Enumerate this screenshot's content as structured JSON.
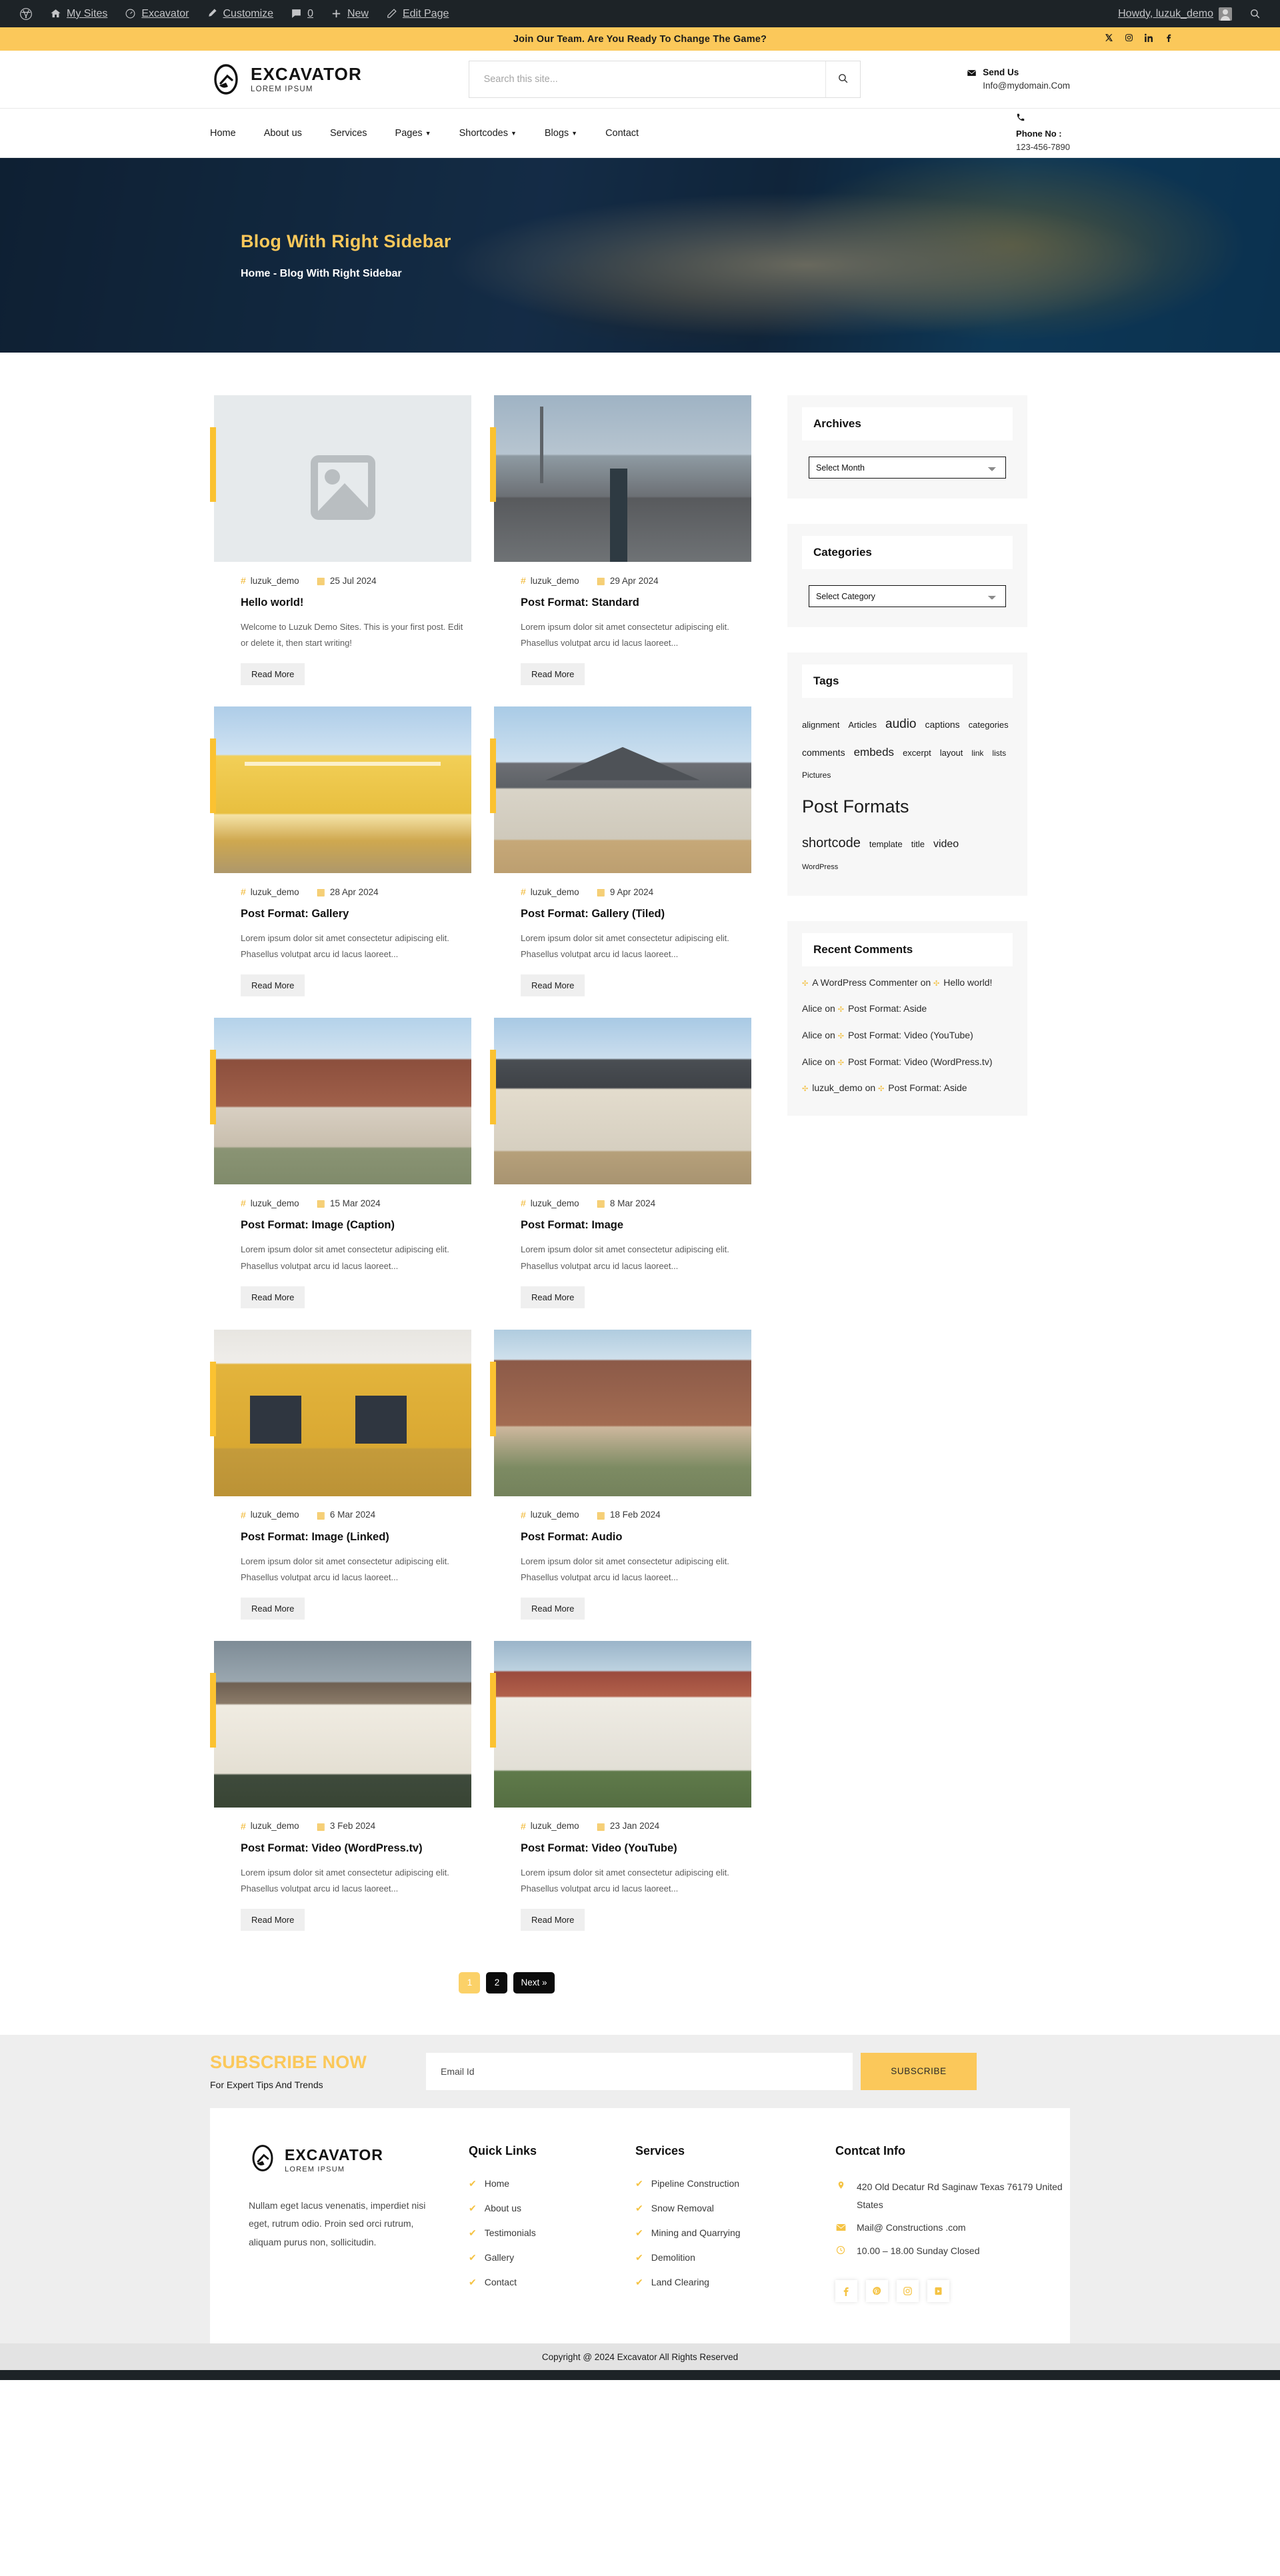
{
  "adminbar": {
    "items": [
      {
        "icon": "wordpress-icon",
        "label": ""
      },
      {
        "icon": "sites-icon",
        "label": "My Sites"
      },
      {
        "icon": "dashboard-icon",
        "label": "Excavator"
      },
      {
        "icon": "brush-icon",
        "label": "Customize"
      },
      {
        "icon": "comment-icon",
        "label": "0"
      },
      {
        "icon": "plus-icon",
        "label": "New"
      },
      {
        "icon": "pencil-icon",
        "label": "Edit Page"
      }
    ],
    "howdy": "Howdy, luzuk_demo",
    "search_icon": "search-icon"
  },
  "topbar": {
    "text": "Join Our Team. Are You Ready To Change The Game?",
    "social": [
      "twitter-x-icon",
      "instagram-icon",
      "linkedin-icon",
      "facebook-icon"
    ]
  },
  "header": {
    "brand_name": "EXCAVATOR",
    "brand_tagline": "LOREM IPSUM",
    "search_placeholder": "Search this site...",
    "search_value": "",
    "contact_label": "Send Us",
    "contact_value": "Info@mydomain.Com"
  },
  "nav": {
    "items": [
      {
        "label": "Home",
        "caret": false
      },
      {
        "label": "About us",
        "caret": false
      },
      {
        "label": "Services",
        "caret": false
      },
      {
        "label": "Pages",
        "caret": true
      },
      {
        "label": "Shortcodes",
        "caret": true
      },
      {
        "label": "Blogs",
        "caret": true
      },
      {
        "label": "Contact",
        "caret": false
      }
    ],
    "phone_label": "Phone No :",
    "phone_value": "123-456-7890"
  },
  "hero": {
    "title": "Blog With Right Sidebar",
    "breadcrumb": "Home - Blog With Right Sidebar"
  },
  "posts": [
    {
      "author": "luzuk_demo",
      "date": "25 Jul 2024",
      "title": "Hello world!",
      "excerpt": "Welcome to Luzuk Demo Sites. This is your first post. Edit or delete it, then start writing!",
      "read_more": "Read More",
      "thumb": "placeholder"
    },
    {
      "author": "luzuk_demo",
      "date": "29 Apr 2024",
      "title": "Post Format: Standard",
      "excerpt": "Lorem ipsum dolor sit amet consectetur adipiscing elit. Phasellus volutpat arcu id lacus laoreet...",
      "read_more": "Read More",
      "thumb": "t-construction"
    },
    {
      "author": "luzuk_demo",
      "date": "28 Apr 2024",
      "title": "Post Format: Gallery",
      "excerpt": "Lorem ipsum dolor sit amet consectetur adipiscing elit. Phasellus volutpat arcu id lacus laoreet...",
      "read_more": "Read More",
      "thumb": "t-yellowbldg"
    },
    {
      "author": "luzuk_demo",
      "date": "9 Apr 2024",
      "title": "Post Format: Gallery (Tiled)",
      "excerpt": "Lorem ipsum dolor sit amet consectetur adipiscing elit. Phasellus volutpat arcu id lacus laoreet...",
      "read_more": "Read More",
      "thumb": "t-house1"
    },
    {
      "author": "luzuk_demo",
      "date": "15 Mar 2024",
      "title": "Post Format: Image (Caption)",
      "excerpt": "Lorem ipsum dolor sit amet consectetur adipiscing elit. Phasellus volutpat arcu id lacus laoreet...",
      "read_more": "Read More",
      "thumb": "t-houses"
    },
    {
      "author": "luzuk_demo",
      "date": "8 Mar 2024",
      "title": "Post Format: Image",
      "excerpt": "Lorem ipsum dolor sit amet consectetur adipiscing elit. Phasellus volutpat arcu id lacus laoreet...",
      "read_more": "Read More",
      "thumb": "t-house2"
    },
    {
      "author": "luzuk_demo",
      "date": "6 Mar 2024",
      "title": "Post Format: Image (Linked)",
      "excerpt": "Lorem ipsum dolor sit amet consectetur adipiscing elit. Phasellus volutpat arcu id lacus laoreet...",
      "read_more": "Read More",
      "thumb": "t-ochre"
    },
    {
      "author": "luzuk_demo",
      "date": "18 Feb 2024",
      "title": "Post Format: Audio",
      "excerpt": "Lorem ipsum dolor sit amet consectetur adipiscing elit. Phasellus volutpat arcu id lacus laoreet...",
      "read_more": "Read More",
      "thumb": "t-brick"
    },
    {
      "author": "luzuk_demo",
      "date": "3 Feb 2024",
      "title": "Post Format: Video (WordPress.tv)",
      "excerpt": "Lorem ipsum dolor sit amet consectetur adipiscing elit. Phasellus volutpat arcu id lacus laoreet...",
      "read_more": "Read More",
      "thumb": "t-tower"
    },
    {
      "author": "luzuk_demo",
      "date": "23 Jan 2024",
      "title": "Post Format: Video (YouTube)",
      "excerpt": "Lorem ipsum dolor sit amet consectetur adipiscing elit. Phasellus volutpat arcu id lacus laoreet...",
      "read_more": "Read More",
      "thumb": "t-apart"
    }
  ],
  "sidebar": {
    "archives": {
      "title": "Archives",
      "select_value": "Select Month"
    },
    "categories": {
      "title": "Categories",
      "select_value": "Select Category"
    },
    "tags": {
      "title": "Tags",
      "items": [
        {
          "label": "alignment",
          "size": 13
        },
        {
          "label": "Articles",
          "size": 13
        },
        {
          "label": "audio",
          "size": 19
        },
        {
          "label": "captions",
          "size": 14
        },
        {
          "label": "categories",
          "size": 13
        },
        {
          "label": "comments",
          "size": 14
        },
        {
          "label": "embeds",
          "size": 17
        },
        {
          "label": "excerpt",
          "size": 13
        },
        {
          "label": "layout",
          "size": 13
        },
        {
          "label": "link",
          "size": 12
        },
        {
          "label": "lists",
          "size": 12
        },
        {
          "label": "Pictures",
          "size": 12
        },
        {
          "label": "Post Formats",
          "size": 27
        },
        {
          "label": "shortcode",
          "size": 20
        },
        {
          "label": "template",
          "size": 13
        },
        {
          "label": "title",
          "size": 13
        },
        {
          "label": "video",
          "size": 16
        },
        {
          "label": "WordPress",
          "size": 11
        }
      ]
    },
    "recent_comments": {
      "title": "Recent Comments",
      "items": [
        {
          "author": "A WordPress Commenter",
          "on": "on",
          "post": "Hello world!"
        },
        {
          "author": "Alice",
          "on": "on",
          "post": "Post Format: Aside"
        },
        {
          "author": "Alice",
          "on": "on",
          "post": "Post Format: Video (YouTube)"
        },
        {
          "author": "Alice",
          "on": "on",
          "post": "Post Format: Video (WordPress.tv)"
        },
        {
          "author": "luzuk_demo",
          "on": "on",
          "post": "Post Format: Aside"
        }
      ]
    }
  },
  "pagination": {
    "pages": [
      "1",
      "2"
    ],
    "next": "Next »",
    "active": "1"
  },
  "subscribe": {
    "heading": "SUBSCRIBE NOW",
    "subheading": "For Expert Tips And Trends",
    "placeholder": "Email Id",
    "value": "",
    "button": "SUBSCRIBE"
  },
  "footer": {
    "brand_name": "EXCAVATOR",
    "brand_tagline": "LOREM IPSUM",
    "about": "Nullam eget lacus venenatis, imperdiet nisi eget, rutrum odio. Proin sed orci rutrum, aliquam purus non, sollicitudin.",
    "quick_links_title": "Quick Links",
    "quick_links": [
      "Home",
      "About us",
      "Testimonials",
      "Gallery",
      "Contact"
    ],
    "services_title": "Services",
    "services": [
      "Pipeline Construction",
      "Snow Removal",
      "Mining and Quarrying",
      "Demolition",
      "Land Clearing"
    ],
    "contact_title": "Contcat Info",
    "contact": [
      {
        "icon": "map-pin-icon",
        "text": "420 Old Decatur Rd Saginaw Texas 76179 United States"
      },
      {
        "icon": "envelope-icon",
        "text": "Mail@ Constructions .com"
      },
      {
        "icon": "clock-icon",
        "text": "10.00 – 18.00 Sunday Closed"
      }
    ],
    "social": [
      "facebook-icon",
      "pinterest-icon",
      "instagram-icon",
      "youtube-icon"
    ],
    "copyright": "Copyright @ 2024 Excavator All Rights Reserved"
  },
  "colors": {
    "accent": "#fbc85a",
    "dark": "#1d2327",
    "tag_yellow": "#f0b429"
  }
}
